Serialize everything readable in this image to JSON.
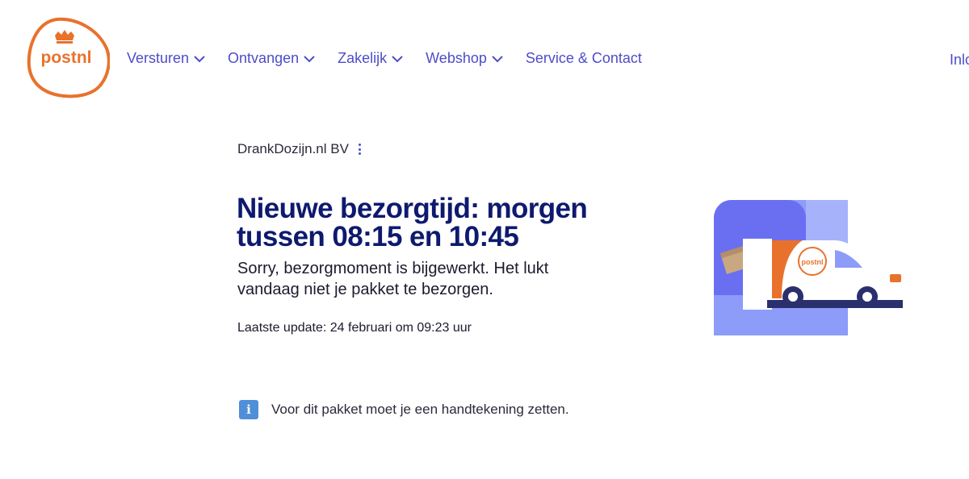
{
  "brand": {
    "logo_text": "postnl",
    "accent": "#e8722c",
    "nav_color": "#4d4dc8",
    "headline_color": "#0e1a6e"
  },
  "nav": {
    "items": [
      {
        "label": "Versturen",
        "icon": "chevron-down-icon"
      },
      {
        "label": "Ontvangen",
        "icon": "chevron-down-icon"
      },
      {
        "label": "Zakelijk",
        "icon": "chevron-down-icon"
      },
      {
        "label": "Webshop",
        "icon": "chevron-down-icon"
      },
      {
        "label": "Service & Contact"
      }
    ],
    "login_label": "Inlo"
  },
  "shipment": {
    "sender": "DrankDozijn.nl BV",
    "headline": "Nieuwe bezorgtijd: morgen tussen 08:15 en 10:45",
    "message": "Sorry, bezorgmoment is bijgewerkt. Het lukt vandaag niet je pakket te bezorgen.",
    "last_update": "Laatste update: 24 februari om 09:23 uur"
  },
  "notice": {
    "icon": "info-icon",
    "icon_glyph": "i",
    "text": "Voor dit pakket moet je een handtekening zetten."
  },
  "illustration": {
    "van_logo_text": "postnl"
  }
}
